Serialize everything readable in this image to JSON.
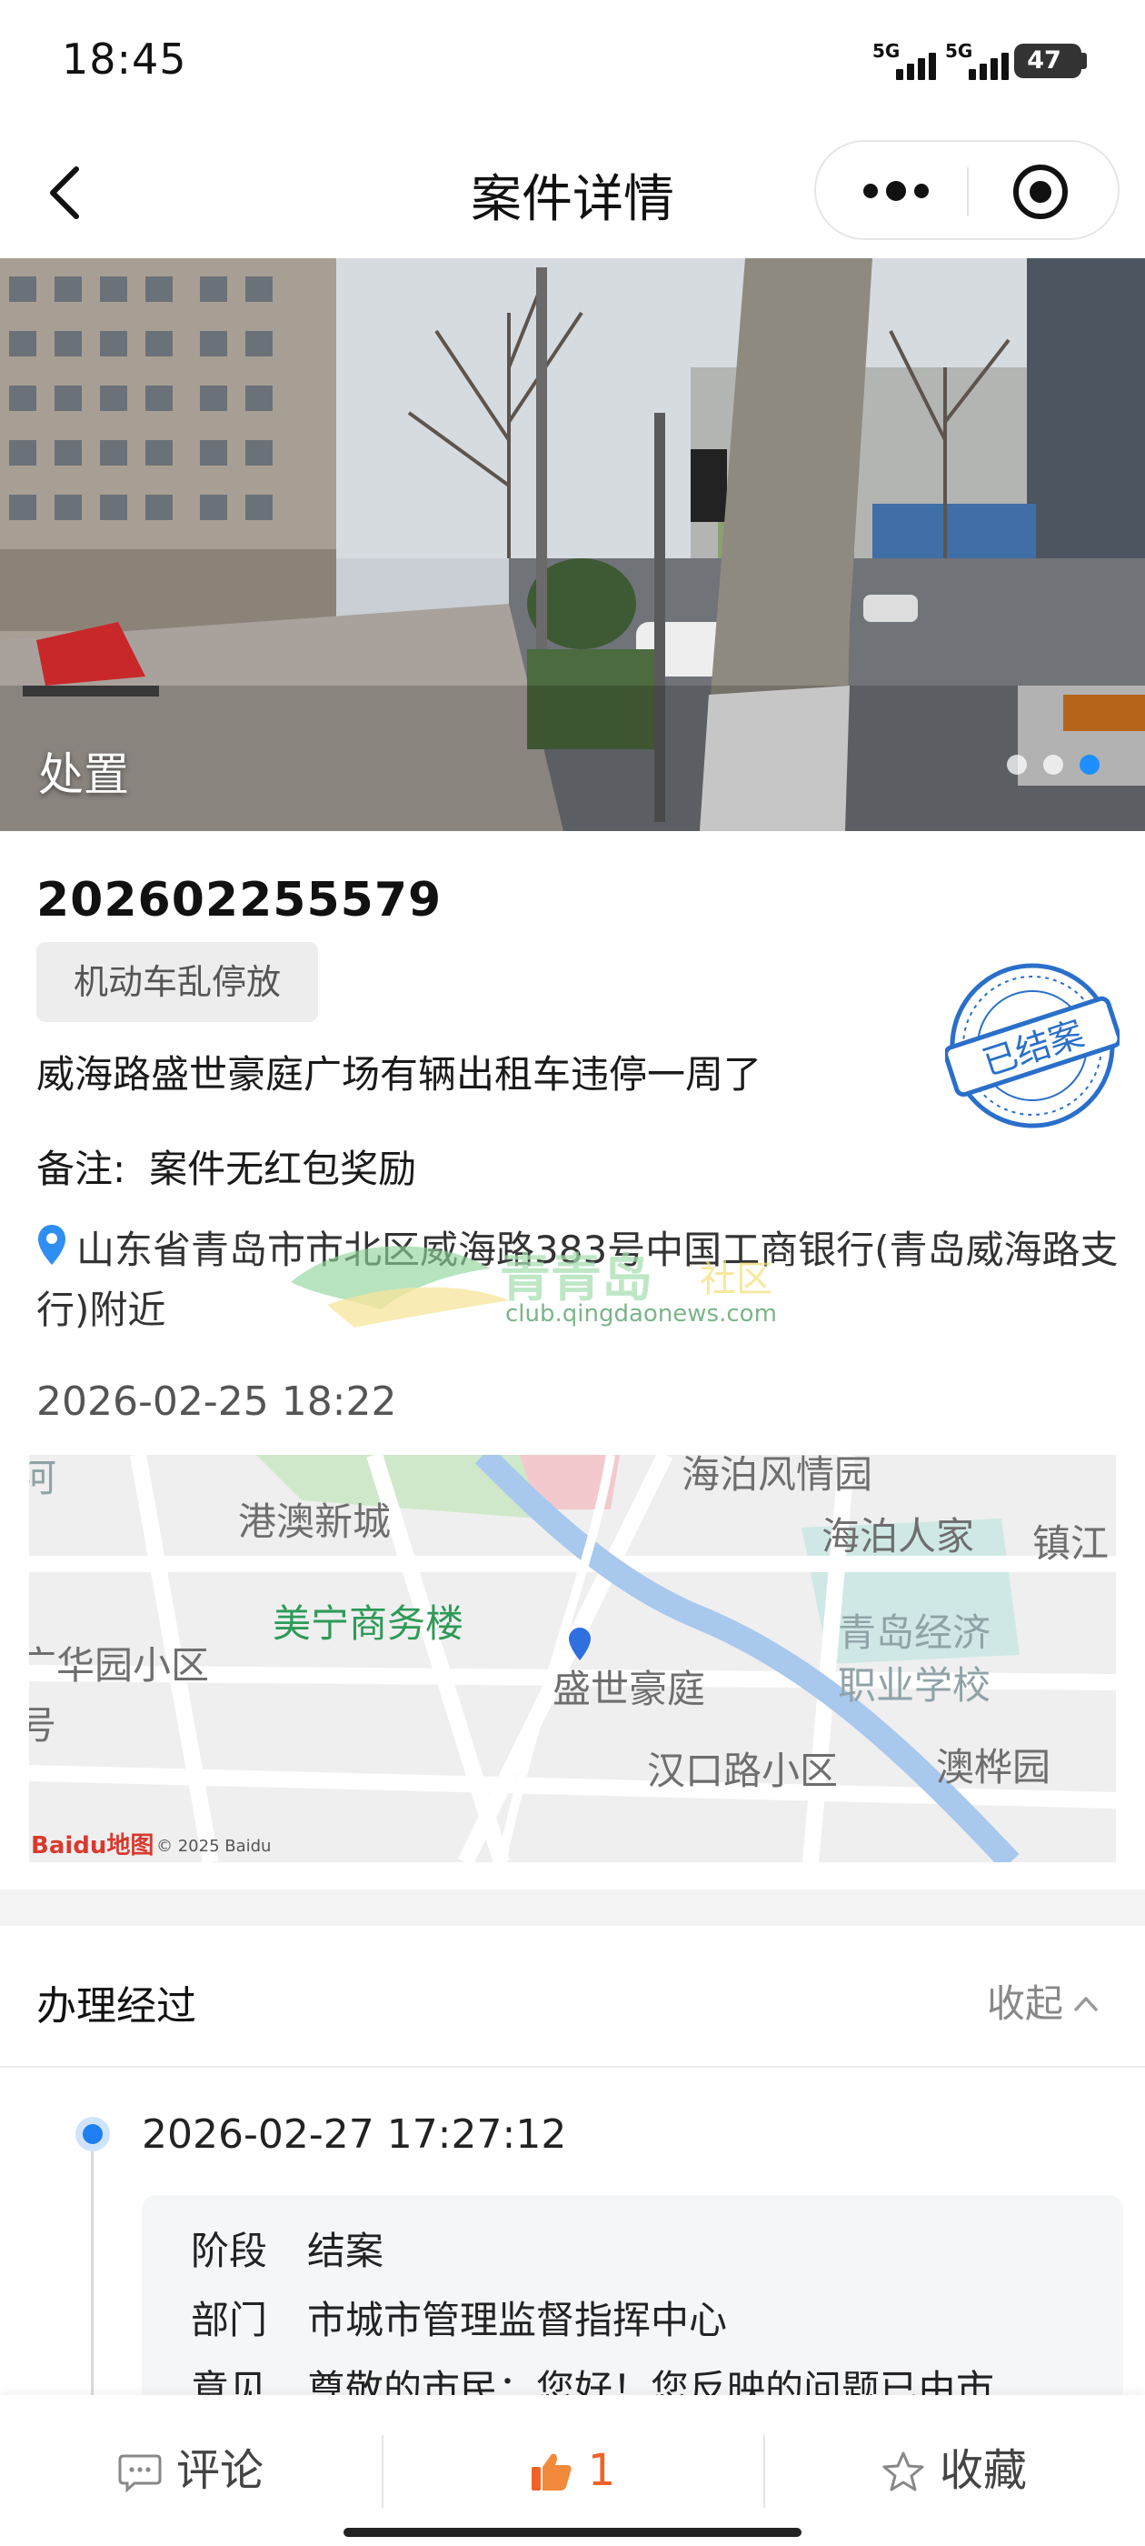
{
  "status_bar": {
    "time": "18:45",
    "signal_1": "5G",
    "signal_2": "5G",
    "battery": "47"
  },
  "nav": {
    "title": "案件详情",
    "icons": [
      "back-arrow-icon",
      "more-dots-icon",
      "target-icon"
    ]
  },
  "hero": {
    "caption": "处置",
    "slide_count": 3,
    "active_slide": 3
  },
  "case": {
    "id": "202602255579",
    "category": "机动车乱停放",
    "status_stamp": "已结案",
    "description": "威海路盛世豪庭广场有辆出租车违停一周了",
    "remark_label": "备注:",
    "remark_value": "案件无红包奖励",
    "address": "山东省青岛市市北区威海路383号中国工商银行(青岛威海路支行)附近",
    "timestamp": "2026-02-25 18:22"
  },
  "watermark": {
    "text": "青青岛",
    "text2": "社区",
    "url": "club.qingdaonews.com"
  },
  "map": {
    "labels": [
      "港澳新城",
      "海泊风情园",
      "海泊人家",
      "镇江",
      "美宁商务楼",
      "广华园小区",
      "青岛经济",
      "职业学校",
      "盛世豪庭",
      "澳桦园",
      "汉口路小区",
      "号",
      "河"
    ],
    "logo": "Baidu地图",
    "copyright": "© 2025 Baidu"
  },
  "process": {
    "title": "办理经过",
    "collapse_label": "收起",
    "step_time": "2026-02-27 17:27:12",
    "rows": [
      {
        "key": "阶段",
        "value": "结案"
      },
      {
        "key": "部门",
        "value": "市城市管理监督指挥中心"
      },
      {
        "key": "意见",
        "value": "尊敬的市民：您好！您反映的问题已由市"
      }
    ]
  },
  "bottom_bar": {
    "comment_label": "评论",
    "like_count": "1",
    "favorite_label": "收藏"
  },
  "colors": {
    "accent_blue": "#1f7ff0",
    "stamp_blue": "#2a6fc9",
    "like_orange": "#f06226"
  }
}
